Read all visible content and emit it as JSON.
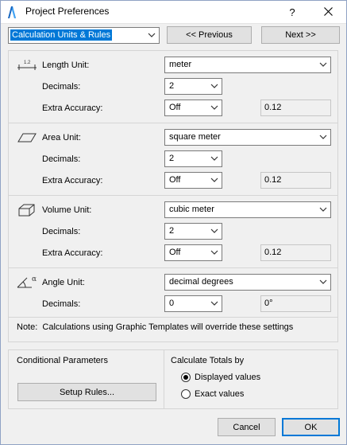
{
  "window": {
    "title": "Project Preferences",
    "help": "?",
    "close": "✕"
  },
  "top": {
    "category_value": "Calculation Units & Rules",
    "previous_label": "<< Previous",
    "next_label": "Next >>"
  },
  "length": {
    "label": "Length Unit:",
    "value": "meter",
    "decimals_label": "Decimals:",
    "decimals_value": "2",
    "accuracy_label": "Extra Accuracy:",
    "accuracy_value": "Off",
    "sample": "0.12"
  },
  "area": {
    "label": "Area Unit:",
    "value": "square meter",
    "decimals_label": "Decimals:",
    "decimals_value": "2",
    "accuracy_label": "Extra Accuracy:",
    "accuracy_value": "Off",
    "sample": "0.12"
  },
  "volume": {
    "label": "Volume Unit:",
    "value": "cubic meter",
    "decimals_label": "Decimals:",
    "decimals_value": "2",
    "accuracy_label": "Extra Accuracy:",
    "accuracy_value": "Off",
    "sample": "0.12"
  },
  "angle": {
    "label": "Angle Unit:",
    "value": "decimal degrees",
    "decimals_label": "Decimals:",
    "decimals_value": "0",
    "sample": "0°"
  },
  "note": "Note:  Calculations using Graphic Templates will override these settings",
  "conditional": {
    "title": "Conditional Parameters",
    "setup_label": "Setup Rules..."
  },
  "totals": {
    "title": "Calculate Totals by",
    "option1": "Displayed values",
    "option2": "Exact values",
    "selected": "Displayed values"
  },
  "footer": {
    "cancel_label": "Cancel",
    "ok_label": "OK"
  },
  "colors": {
    "accent": "#0078d7",
    "border": "#7a7a7a",
    "background": "#f0f0f0"
  }
}
